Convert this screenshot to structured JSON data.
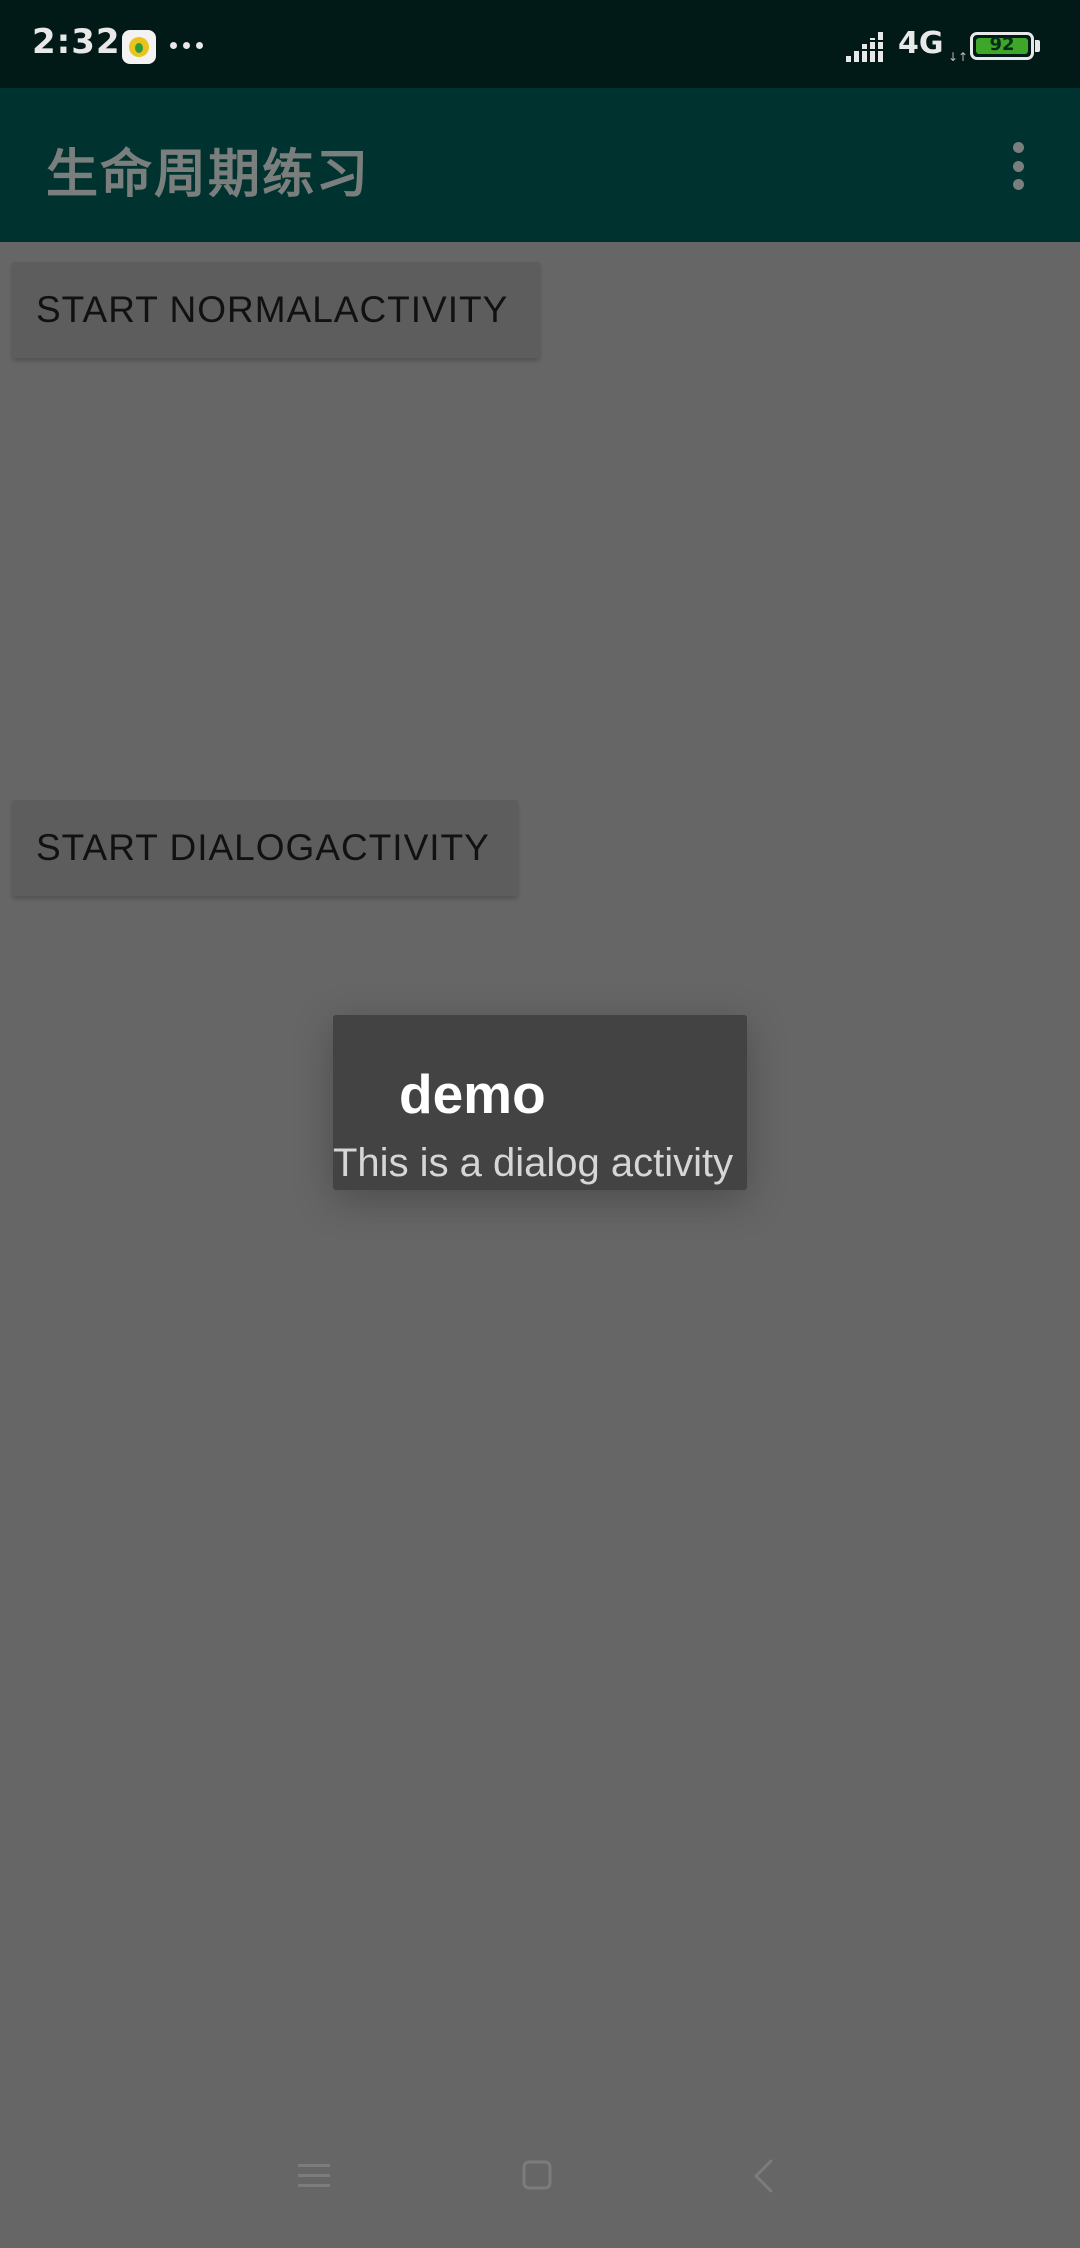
{
  "status_bar": {
    "time": "2:32",
    "network_type": "4G",
    "network_arrows": "↓↑",
    "battery_level": "92",
    "icons": {
      "app_notification": "app-notification-icon",
      "more_notifications": "more-dots-icon",
      "signal": "signal-icon",
      "battery": "battery-icon"
    }
  },
  "app_bar": {
    "title": "生命周期练习",
    "overflow_icon": "overflow-menu-icon"
  },
  "main": {
    "buttons": {
      "start_normal": "START NORMALACTIVITY",
      "start_dialog": "START DIALOGACTIVITY"
    }
  },
  "dialog": {
    "title": "demo",
    "message": "This is a dialog activity"
  },
  "nav_bar": {
    "icons": {
      "menu": "menu-icon",
      "home": "home-icon",
      "back": "back-icon"
    }
  },
  "colors": {
    "status_bar_bg": "#011a17",
    "app_bar_bg": "#003330",
    "scrim_bg": "#666666",
    "dialog_bg": "#434343",
    "button_bg": "#5d5d5d",
    "battery_fill": "#3ea629"
  }
}
